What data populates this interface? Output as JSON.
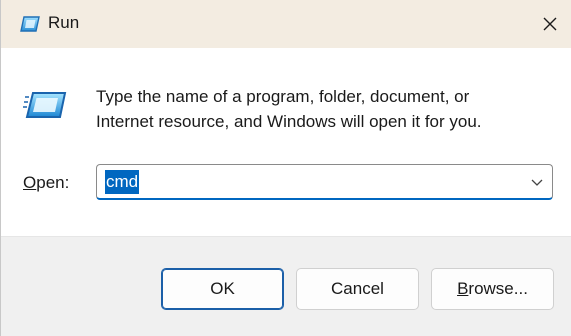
{
  "window": {
    "title": "Run"
  },
  "dialog": {
    "description_line1": "Type the name of a program, folder, document, or",
    "description_line2": "Internet resource, and Windows will open it for you.",
    "open_label_mnemonic": "O",
    "open_label_rest": "pen:",
    "open_value": "cmd"
  },
  "buttons": {
    "ok_label": "OK",
    "cancel_label": "Cancel",
    "browse_mnemonic": "B",
    "browse_rest": "rowse..."
  },
  "icons": {
    "title": "run-icon",
    "close": "close-icon",
    "large": "run-large-icon",
    "dropdown": "chevron-down-icon"
  },
  "colors": {
    "titlebar_bg": "#f3ece1",
    "footer_bg": "#f0f0f0",
    "accent": "#0067c0",
    "ok_border": "#1b5fa8"
  }
}
